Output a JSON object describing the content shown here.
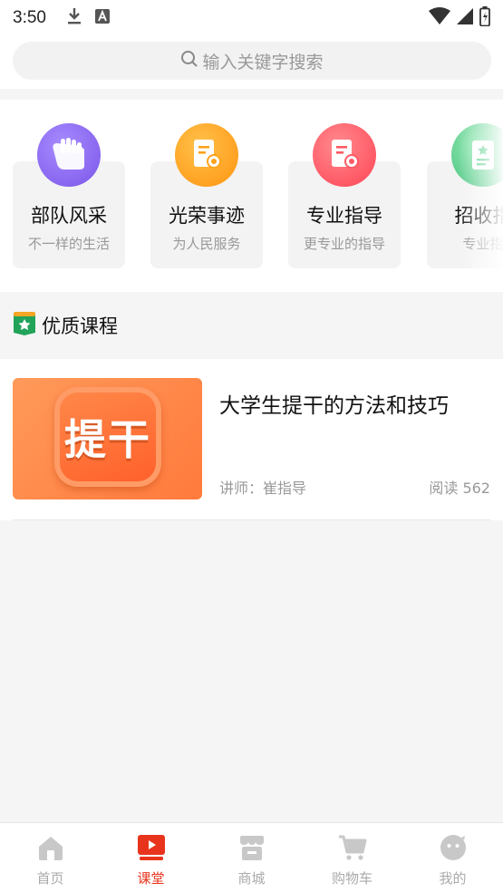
{
  "status_bar": {
    "time": "3:50",
    "icons": [
      "download-icon",
      "text-a-icon",
      "wifi-icon",
      "signal-icon",
      "battery-icon"
    ]
  },
  "search": {
    "placeholder": "输入关键字搜索"
  },
  "categories": [
    {
      "title": "部队风采",
      "subtitle": "不一样的生活",
      "icon": "salute-hand-icon",
      "color": "#8c6cf0"
    },
    {
      "title": "光荣事迹",
      "subtitle": "为人民服务",
      "icon": "certificate-icon",
      "color": "#ffa31a"
    },
    {
      "title": "专业指导",
      "subtitle": "更专业的指导",
      "icon": "certificate-icon",
      "color": "#ff5a66"
    },
    {
      "title": "招收指",
      "subtitle": "专业指",
      "icon": "star-document-icon",
      "color": "#5ccf8a"
    }
  ],
  "section": {
    "title": "优质课程",
    "icon": "star-shield-icon"
  },
  "courses": [
    {
      "thumb_text": "提干",
      "title": "大学生提干的方法和技巧",
      "teacher": "讲师：崔指导",
      "reads": "阅读 562"
    }
  ],
  "nav": [
    {
      "label": "首页",
      "icon": "home-icon",
      "active": false
    },
    {
      "label": "课堂",
      "icon": "play-tv-icon",
      "active": true
    },
    {
      "label": "商城",
      "icon": "store-icon",
      "active": false
    },
    {
      "label": "购物车",
      "icon": "cart-icon",
      "active": false
    },
    {
      "label": "我的",
      "icon": "profile-face-icon",
      "active": false
    }
  ],
  "colors": {
    "accent": "#e8341c",
    "inactive_nav": "#c8c8c8"
  }
}
